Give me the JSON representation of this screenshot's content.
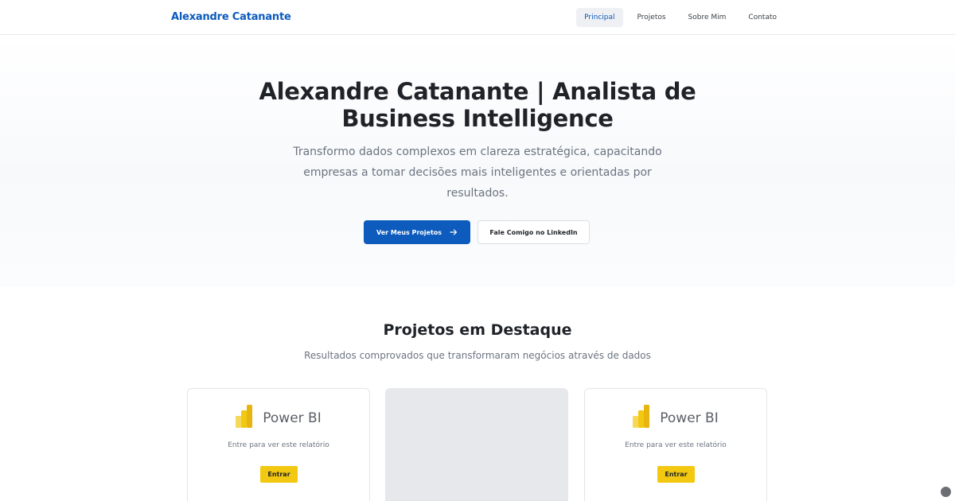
{
  "navbar": {
    "brand": "Alexandre Catanante",
    "links": [
      {
        "label": "Principal",
        "active": true
      },
      {
        "label": "Projetos",
        "active": false
      },
      {
        "label": "Sobre Mim",
        "active": false
      },
      {
        "label": "Contato",
        "active": false
      }
    ]
  },
  "hero": {
    "title_line1": "Alexandre Catanante | Analista de",
    "title_line2": "Business Intelligence",
    "subtitle": "Transformo dados complexos em clareza estratégica, capacitando empresas a tomar decisões mais inteligentes e orientadas por resultados.",
    "primary_button": "Ver Meus Projetos",
    "primary_button_icon": "arrow-right-icon",
    "secondary_button": "Fale Comigo no LinkedIn"
  },
  "projects": {
    "title": "Projetos em Destaque",
    "subtitle": "Resultados comprovados que transformaram negócios através de dados",
    "cards": [
      {
        "type": "powerbi",
        "product": "Power BI",
        "message": "Entre para ver este relatório",
        "button": "Entrar"
      },
      {
        "type": "placeholder"
      },
      {
        "type": "powerbi",
        "product": "Power BI",
        "message": "Entre para ver este relatório",
        "button": "Entrar"
      }
    ]
  },
  "colors": {
    "brand": "#0d5bbd",
    "powerbi_yellow": "#f2c811"
  }
}
